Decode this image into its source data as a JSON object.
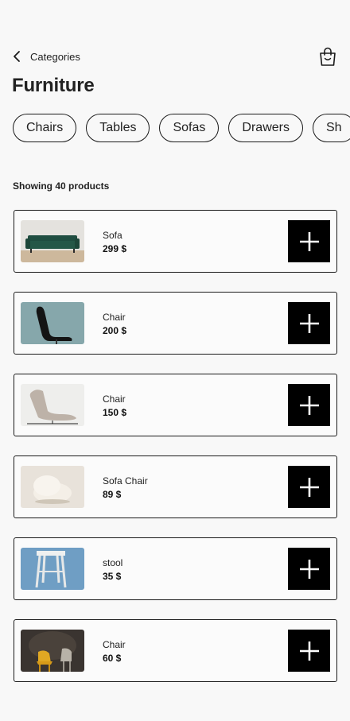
{
  "header": {
    "back_label": "Categories",
    "back_icon": "chevron-left-icon",
    "cart_icon": "shopping-bag-icon"
  },
  "page": {
    "title": "Furniture"
  },
  "chips": [
    "Chairs",
    "Tables",
    "Sofas",
    "Drawers",
    "Sh"
  ],
  "products_count_text": "Showing 40 products",
  "products": [
    {
      "name": "Sofa",
      "price": "299 $",
      "image": "green-sofa"
    },
    {
      "name": "Chair",
      "price": "200 $",
      "image": "black-chair"
    },
    {
      "name": "Chair",
      "price": "150 $",
      "image": "beige-lounge-chair"
    },
    {
      "name": "Sofa Chair",
      "price": "89 $",
      "image": "cream-pouf-chair"
    },
    {
      "name": "stool",
      "price": "35 $",
      "image": "white-stool"
    },
    {
      "name": "Chair",
      "price": "60 $",
      "image": "yellow-chairs"
    }
  ],
  "colors": {
    "background": "#f8f8f8",
    "text": "#222222",
    "add_button": "#000000",
    "border": "#1a1a1a"
  }
}
